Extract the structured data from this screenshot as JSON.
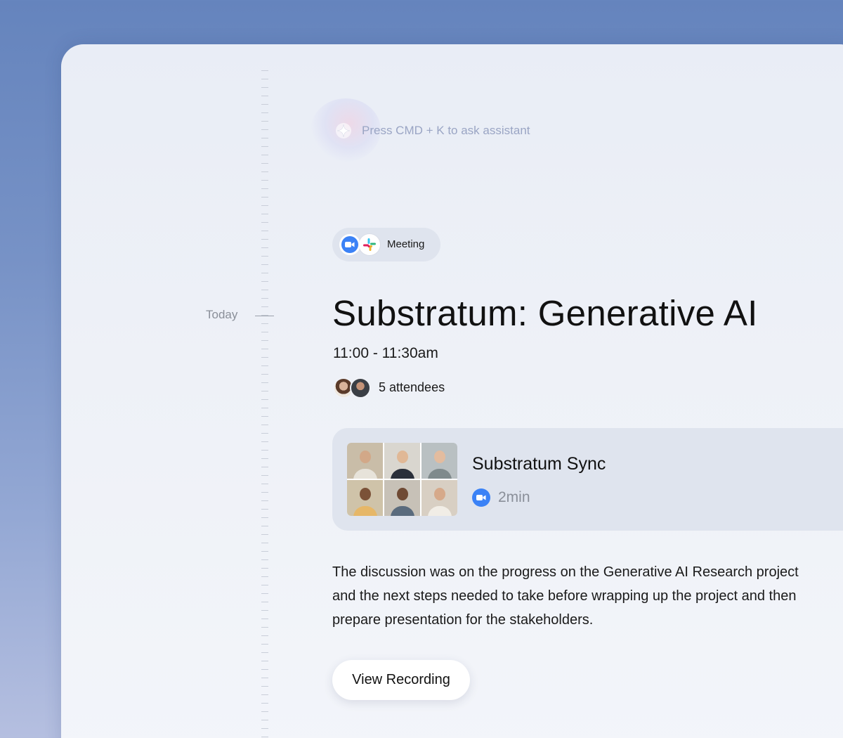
{
  "assistant": {
    "hint": "Press CMD + K to ask assistant",
    "icon": "sparkle-icon"
  },
  "timeline": {
    "today_label": "Today"
  },
  "event": {
    "tag": {
      "label": "Meeting",
      "icons": [
        "zoom-icon",
        "slack-icon"
      ]
    },
    "title": "Substratum: Generative AI",
    "time": "11:00 - 11:30am",
    "attendees_text": "5 attendees",
    "recording": {
      "title": "Substratum Sync",
      "duration": "2min",
      "source_icon": "zoom-icon"
    },
    "summary_lines": [
      "The discussion was on the progress on the Generative AI Research project",
      "and the next steps needed to take before wrapping up the project and then",
      "prepare presentation for the stakeholders."
    ],
    "view_button": "View Recording"
  },
  "colors": {
    "background_top": "#6584bd",
    "panel": "#eef1f7",
    "card": "#dfe4ee",
    "zoom_blue": "#3b82f6"
  }
}
